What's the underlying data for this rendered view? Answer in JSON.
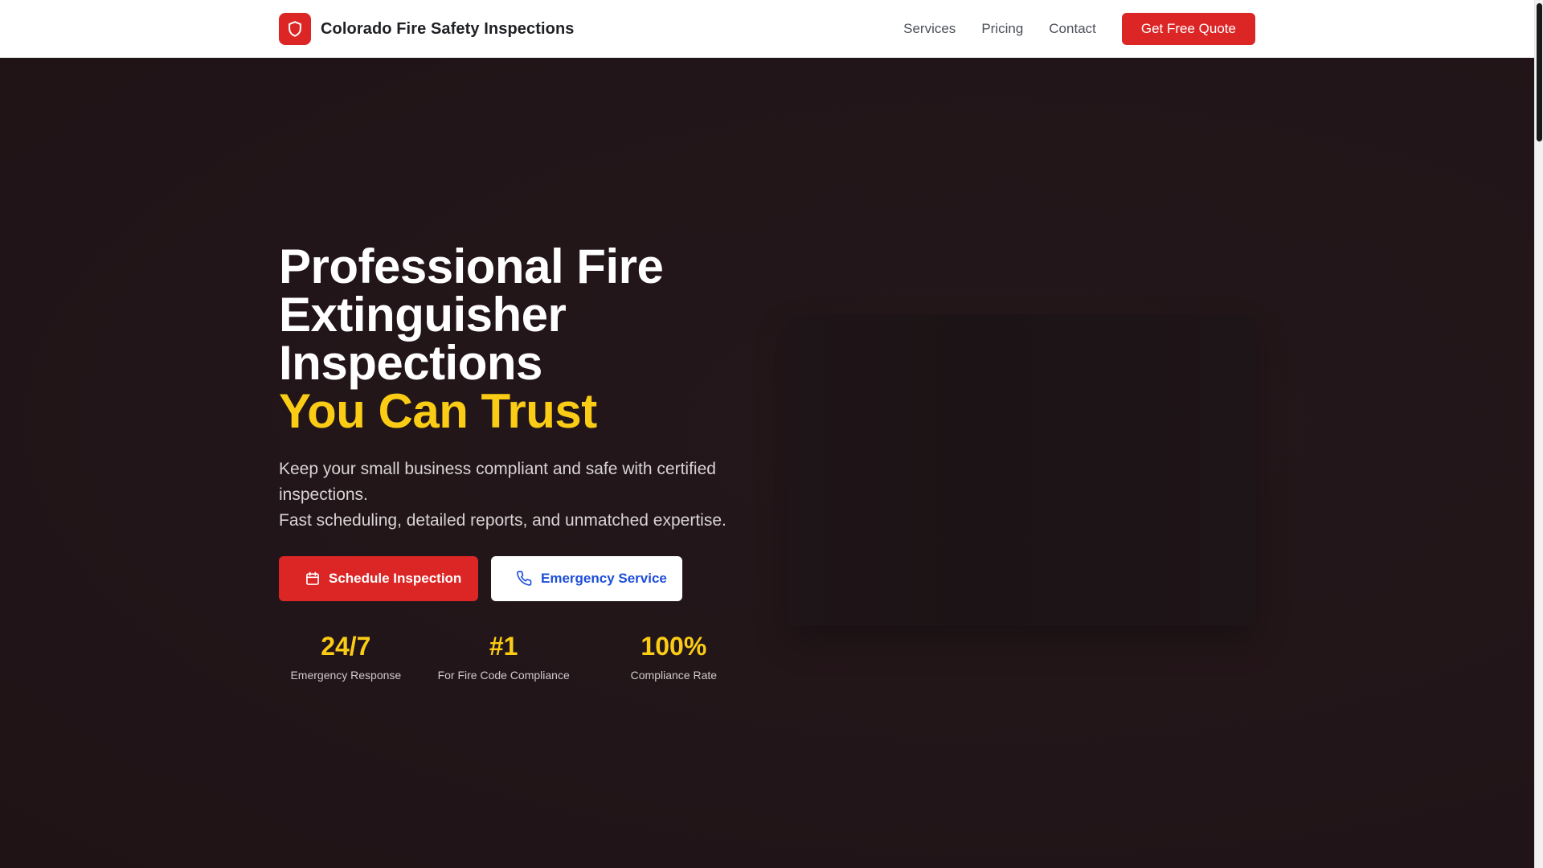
{
  "header": {
    "brand_name": "Colorado Fire Safety Inspections",
    "logo_icon": "shield-icon",
    "nav": [
      {
        "label": "Services"
      },
      {
        "label": "Pricing"
      },
      {
        "label": "Contact"
      }
    ],
    "cta_label": "Get Free Quote"
  },
  "hero": {
    "title_lines": [
      "Professional Fire",
      "Extinguisher",
      "Inspections"
    ],
    "title_accent": "You Can Trust",
    "subtitle_lines": [
      "Keep your small business compliant and safe with certified",
      "inspections.",
      "Fast scheduling, detailed reports, and unmatched expertise."
    ],
    "primary_cta": {
      "label": "Schedule Inspection",
      "icon": "calendar-icon"
    },
    "secondary_cta": {
      "label": "Emergency Service",
      "icon": "phone-icon"
    },
    "stats": [
      {
        "value": "24/7",
        "label": "Emergency Response"
      },
      {
        "value": "#1",
        "label": "For Fire Code Compliance"
      },
      {
        "value": "100%",
        "label": "Compliance Rate"
      }
    ]
  },
  "colors": {
    "brand_red": "#dc2626",
    "accent_yellow": "#facc15",
    "hero_bg": "#231619",
    "secondary_text_blue": "#1d4ed8"
  }
}
